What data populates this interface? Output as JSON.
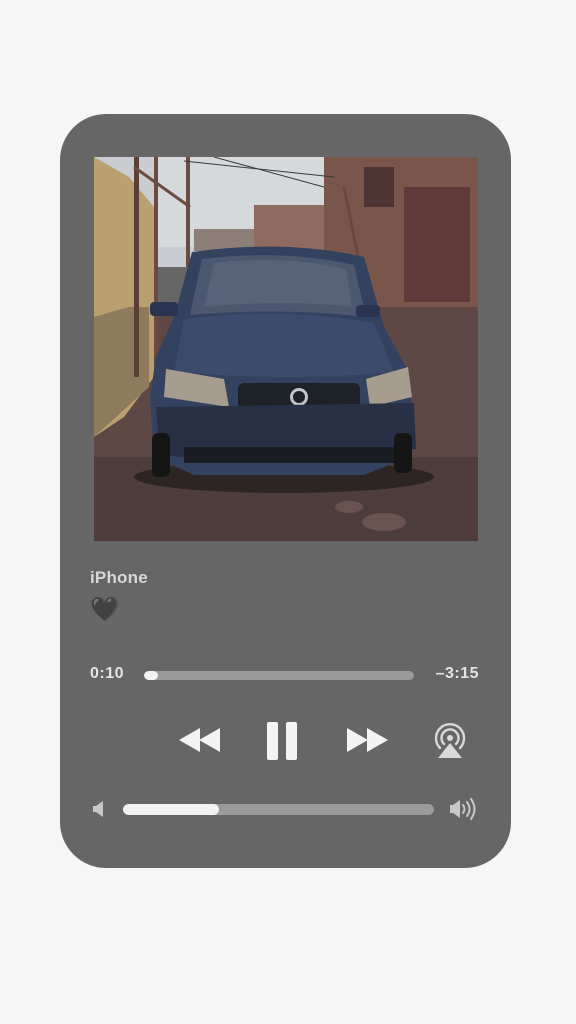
{
  "player": {
    "title": "iPhone",
    "subtitle": "🖤",
    "time_elapsed": "0:10",
    "time_remaining": "–3:15",
    "progress": 0.05,
    "volume": 0.31,
    "colors": {
      "card": "#666666",
      "page": "#f7f6f7",
      "track": "#9a9a9a",
      "fill": "#f2f2f2"
    }
  },
  "icons": {
    "rewind": "rewind-icon",
    "pause": "pause-icon",
    "forward": "fast-forward-icon",
    "airplay": "airplay-icon",
    "volume_min": "speaker-low-icon",
    "volume_max": "speaker-high-icon"
  }
}
